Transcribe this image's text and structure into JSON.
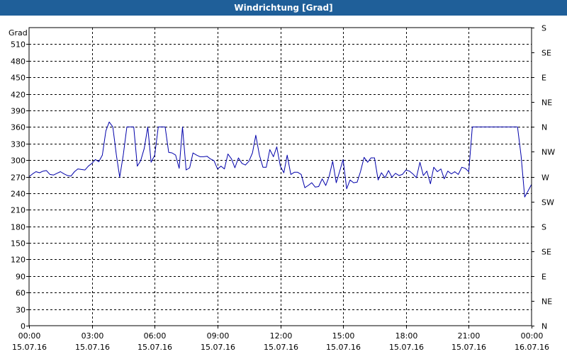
{
  "window": {
    "title": "Windrichtung [Grad]"
  },
  "colors": {
    "titlebar": "#1f5f99",
    "series": "#0000aa",
    "grid": "#000000"
  },
  "chart_data": {
    "type": "line",
    "title": "Windrichtung [Grad]",
    "ylabel": "Grad",
    "ylim": [
      0,
      540
    ],
    "xlim_hours": [
      0,
      24
    ],
    "grid": true,
    "y_ticks": [
      0,
      30,
      60,
      90,
      120,
      150,
      180,
      210,
      240,
      270,
      300,
      330,
      360,
      390,
      420,
      450,
      480,
      510
    ],
    "right_axis_labels": [
      {
        "value": 0,
        "label": "N"
      },
      {
        "value": 45,
        "label": "NE"
      },
      {
        "value": 90,
        "label": "E"
      },
      {
        "value": 135,
        "label": "SE"
      },
      {
        "value": 180,
        "label": "S"
      },
      {
        "value": 225,
        "label": "SW"
      },
      {
        "value": 270,
        "label": "W"
      },
      {
        "value": 315,
        "label": "NW"
      },
      {
        "value": 360,
        "label": "N"
      },
      {
        "value": 405,
        "label": "NE"
      },
      {
        "value": 450,
        "label": "E"
      },
      {
        "value": 495,
        "label": "SE"
      },
      {
        "value": 540,
        "label": "S"
      }
    ],
    "x_ticks": [
      {
        "hour": 0,
        "time": "00:00",
        "date": "15.07.16"
      },
      {
        "hour": 3,
        "time": "03:00",
        "date": "15.07.16"
      },
      {
        "hour": 6,
        "time": "06:00",
        "date": "15.07.16"
      },
      {
        "hour": 9,
        "time": "09:00",
        "date": "15.07.16"
      },
      {
        "hour": 12,
        "time": "12:00",
        "date": "15.07.16"
      },
      {
        "hour": 15,
        "time": "15:00",
        "date": "15.07.16"
      },
      {
        "hour": 18,
        "time": "18:00",
        "date": "15.07.16"
      },
      {
        "hour": 21,
        "time": "21:00",
        "date": "15.07.16"
      },
      {
        "hour": 24,
        "time": "00:00",
        "date": "16.07.16"
      }
    ],
    "series": [
      {
        "values": [
          [
            0.0,
            270
          ],
          [
            0.17,
            275
          ],
          [
            0.33,
            279
          ],
          [
            0.5,
            277
          ],
          [
            0.67,
            280
          ],
          [
            0.83,
            281
          ],
          [
            1.0,
            274
          ],
          [
            1.17,
            273
          ],
          [
            1.33,
            276
          ],
          [
            1.5,
            279
          ],
          [
            1.67,
            275
          ],
          [
            1.83,
            272
          ],
          [
            2.0,
            271
          ],
          [
            2.17,
            279
          ],
          [
            2.33,
            284
          ],
          [
            2.5,
            283
          ],
          [
            2.67,
            282
          ],
          [
            2.83,
            289
          ],
          [
            3.0,
            294
          ],
          [
            3.17,
            301
          ],
          [
            3.33,
            297
          ],
          [
            3.5,
            309
          ],
          [
            3.67,
            353
          ],
          [
            3.83,
            369
          ],
          [
            4.0,
            360
          ],
          [
            4.17,
            309
          ],
          [
            4.33,
            269
          ],
          [
            4.5,
            309
          ],
          [
            4.67,
            360
          ],
          [
            4.83,
            360
          ],
          [
            5.0,
            360
          ],
          [
            5.17,
            289
          ],
          [
            5.33,
            299
          ],
          [
            5.5,
            321
          ],
          [
            5.67,
            360
          ],
          [
            5.83,
            296
          ],
          [
            6.0,
            309
          ],
          [
            6.17,
            360
          ],
          [
            6.33,
            360
          ],
          [
            6.5,
            360
          ],
          [
            6.67,
            314
          ],
          [
            6.83,
            313
          ],
          [
            7.0,
            309
          ],
          [
            7.17,
            285
          ],
          [
            7.33,
            360
          ],
          [
            7.5,
            282
          ],
          [
            7.67,
            286
          ],
          [
            7.83,
            313
          ],
          [
            8.0,
            309
          ],
          [
            8.17,
            306
          ],
          [
            8.33,
            306
          ],
          [
            8.5,
            307
          ],
          [
            8.67,
            302
          ],
          [
            8.83,
            299
          ],
          [
            9.0,
            284
          ],
          [
            9.17,
            289
          ],
          [
            9.33,
            284
          ],
          [
            9.5,
            311
          ],
          [
            9.67,
            302
          ],
          [
            9.83,
            286
          ],
          [
            10.0,
            304
          ],
          [
            10.17,
            294
          ],
          [
            10.33,
            291
          ],
          [
            10.5,
            298
          ],
          [
            10.67,
            313
          ],
          [
            10.83,
            345
          ],
          [
            11.0,
            309
          ],
          [
            11.17,
            287
          ],
          [
            11.33,
            287
          ],
          [
            11.5,
            319
          ],
          [
            11.67,
            306
          ],
          [
            11.83,
            324
          ],
          [
            12.0,
            289
          ],
          [
            12.17,
            277
          ],
          [
            12.33,
            309
          ],
          [
            12.5,
            274
          ],
          [
            12.67,
            278
          ],
          [
            12.83,
            278
          ],
          [
            13.0,
            274
          ],
          [
            13.17,
            250
          ],
          [
            13.33,
            254
          ],
          [
            13.5,
            259
          ],
          [
            13.67,
            251
          ],
          [
            13.83,
            252
          ],
          [
            14.0,
            266
          ],
          [
            14.17,
            254
          ],
          [
            14.33,
            270
          ],
          [
            14.5,
            298
          ],
          [
            14.67,
            259
          ],
          [
            14.83,
            279
          ],
          [
            15.0,
            301
          ],
          [
            15.17,
            248
          ],
          [
            15.33,
            264
          ],
          [
            15.5,
            259
          ],
          [
            15.67,
            260
          ],
          [
            15.83,
            279
          ],
          [
            16.0,
            305
          ],
          [
            16.17,
            296
          ],
          [
            16.33,
            304
          ],
          [
            16.5,
            304
          ],
          [
            16.67,
            264
          ],
          [
            16.83,
            277
          ],
          [
            17.0,
            268
          ],
          [
            17.17,
            281
          ],
          [
            17.33,
            269
          ],
          [
            17.5,
            276
          ],
          [
            17.67,
            272
          ],
          [
            17.83,
            274
          ],
          [
            18.0,
            282
          ],
          [
            18.17,
            280
          ],
          [
            18.33,
            275
          ],
          [
            18.5,
            268
          ],
          [
            18.67,
            296
          ],
          [
            18.83,
            272
          ],
          [
            19.0,
            280
          ],
          [
            19.17,
            257
          ],
          [
            19.33,
            287
          ],
          [
            19.5,
            279
          ],
          [
            19.67,
            284
          ],
          [
            19.83,
            266
          ],
          [
            20.0,
            280
          ],
          [
            20.17,
            275
          ],
          [
            20.33,
            279
          ],
          [
            20.5,
            274
          ],
          [
            20.67,
            287
          ],
          [
            20.83,
            285
          ],
          [
            21.0,
            279
          ],
          [
            21.17,
            360
          ],
          [
            21.5,
            360
          ],
          [
            22.0,
            360
          ],
          [
            22.5,
            360
          ],
          [
            23.0,
            360
          ],
          [
            23.33,
            360
          ],
          [
            23.5,
            308
          ],
          [
            23.67,
            233
          ],
          [
            23.83,
            244
          ],
          [
            24.0,
            256
          ]
        ]
      }
    ]
  }
}
